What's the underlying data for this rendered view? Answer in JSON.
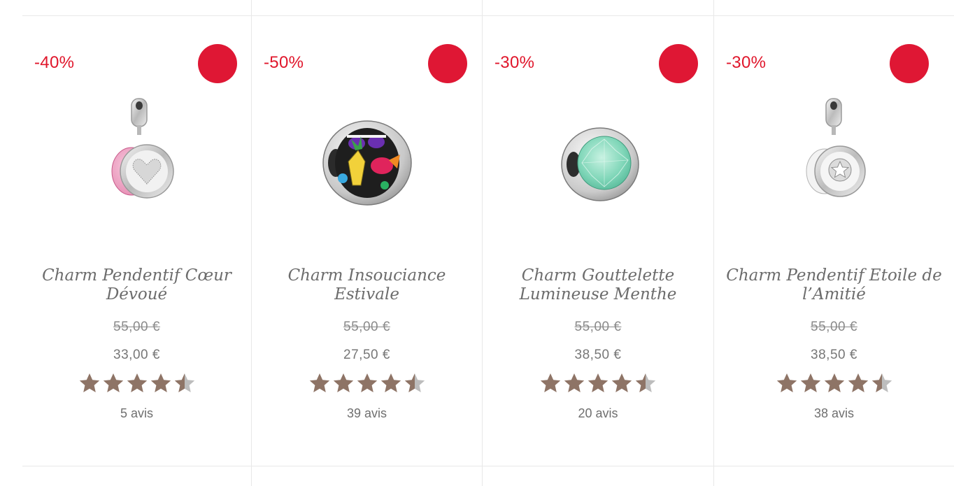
{
  "colors": {
    "discount": "#e0162b",
    "badge": "#df1734",
    "star": "#8e7466",
    "star_empty": "#bdbdbd"
  },
  "products": [
    {
      "discount": "-40%",
      "name": "Charm Pendentif Cœur Dévoué",
      "old_price": "55,00 €",
      "price": "33,00 €",
      "rating": 4.5,
      "reviews": "5 avis",
      "image_icon": "pink-heart-dangle-charm-icon"
    },
    {
      "discount": "-50%",
      "name": "Charm Insouciance Estivale",
      "old_price": "55,00 €",
      "price": "27,50 €",
      "rating": 4.5,
      "reviews": "39 avis",
      "image_icon": "summer-fun-charm-icon"
    },
    {
      "discount": "-30%",
      "name": "Charm Gouttelette Lumineuse Menthe",
      "old_price": "55,00 €",
      "price": "38,50 €",
      "rating": 4.5,
      "reviews": "20 avis",
      "image_icon": "mint-droplet-charm-icon"
    },
    {
      "discount": "-30%",
      "name": "Charm Pendentif Etoile de l’Amitié",
      "old_price": "55,00 €",
      "price": "38,50 €",
      "rating": 4.5,
      "reviews": "38 avis",
      "image_icon": "star-dangle-charm-icon"
    }
  ]
}
